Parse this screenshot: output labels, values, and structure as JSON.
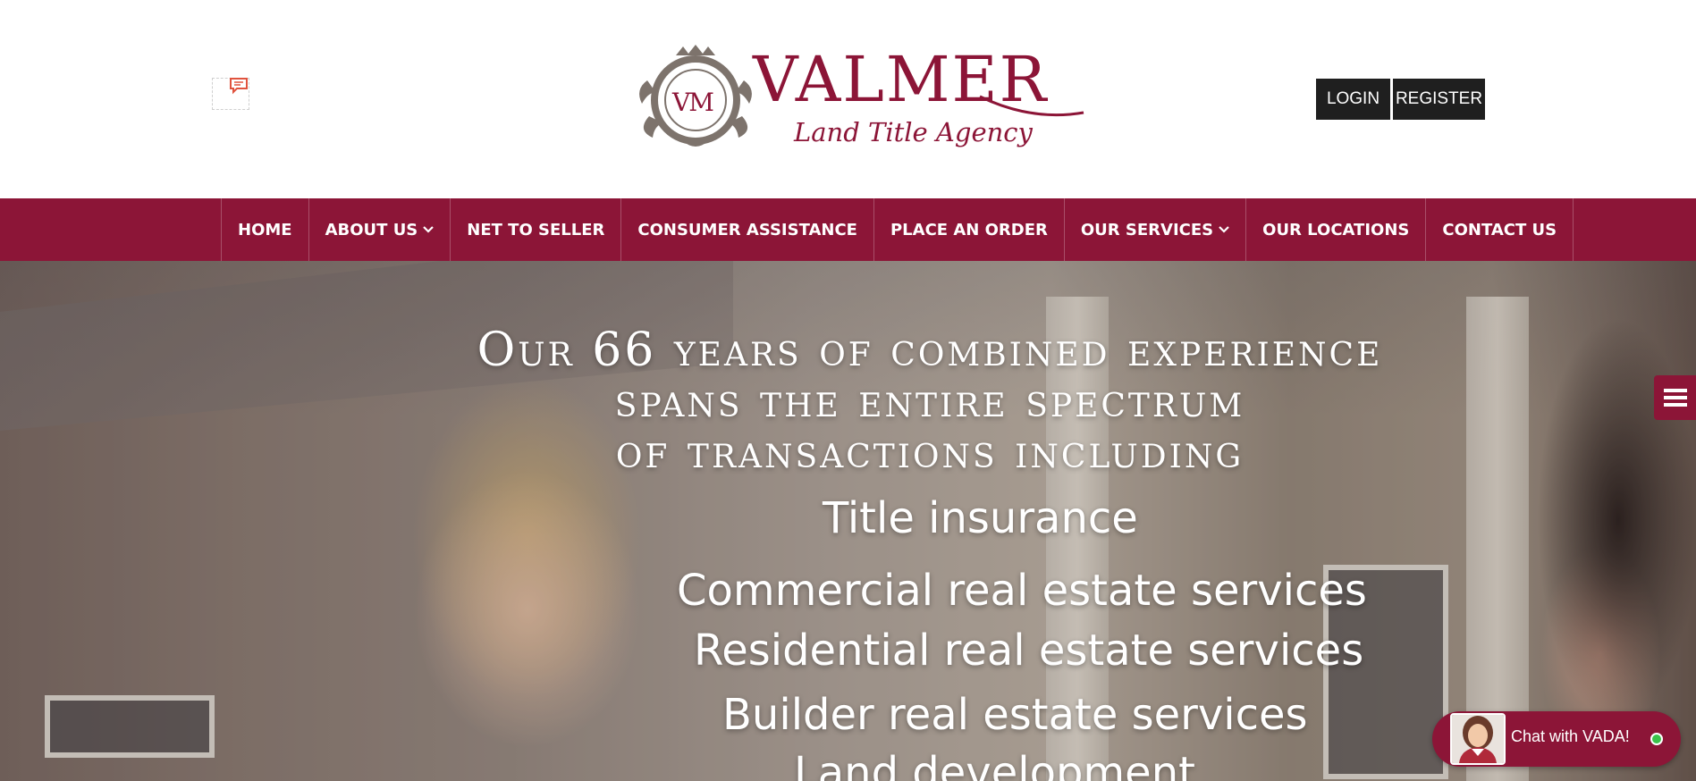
{
  "header": {
    "logo_main": "VALMER",
    "logo_sub": "Land Title Agency",
    "logo_monogram": "VM",
    "login_label": "LOGIN",
    "register_label": "REGISTER"
  },
  "nav": {
    "items": [
      {
        "label": "HOME"
      },
      {
        "label": "ABOUT US",
        "dropdown": true
      },
      {
        "label": "NET TO SELLER"
      },
      {
        "label": "CONSUMER ASSISTANCE"
      },
      {
        "label": "PLACE AN ORDER"
      },
      {
        "label": "OUR SERVICES",
        "dropdown": true
      },
      {
        "label": "OUR LOCATIONS"
      },
      {
        "label": "CONTACT US"
      }
    ]
  },
  "hero": {
    "heading_line1": "Our 66 years of combined experience",
    "heading_line2": "spans the entire spectrum",
    "heading_line3": "of transactions including",
    "services": [
      "Title insurance",
      "Commercial real estate services",
      "Residential real estate services",
      "Builder real estate services",
      "Land development"
    ]
  },
  "chat": {
    "label": "Chat with VADA!",
    "status": "online"
  },
  "icons": {
    "chat_widget": "message-icon",
    "side_menu": "hamburger-menu-icon",
    "dropdown": "chevron-down-icon"
  },
  "colors": {
    "brand": "#8c1537",
    "auth_bg": "#1f1f1f",
    "status_online": "#3ac24a"
  }
}
